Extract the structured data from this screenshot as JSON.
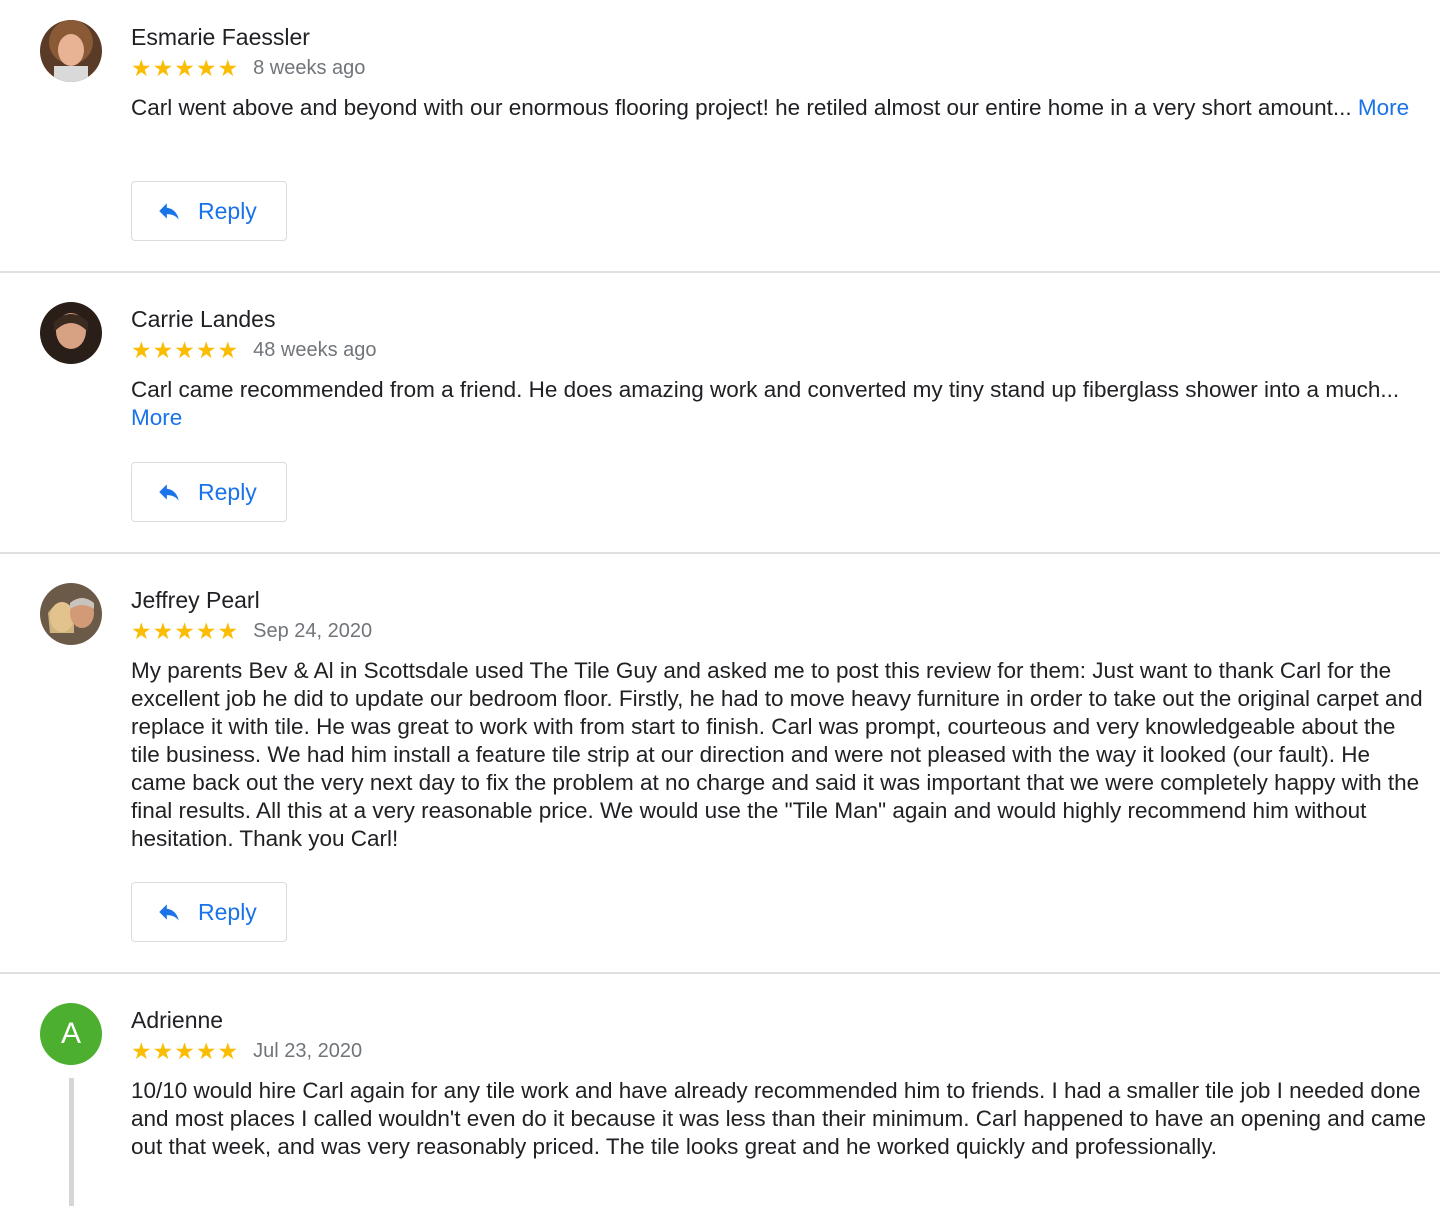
{
  "reviews": [
    {
      "author": "Esmarie Faessler",
      "rating": 5,
      "stars": "★★★★★",
      "date": "8 weeks ago",
      "text": "Carl went above and beyond with our enormous flooring project! he retiled almost our entire home in a very short amount... ",
      "more_label": "More",
      "reply_label": "Reply",
      "avatar": "photo"
    },
    {
      "author": "Carrie Landes",
      "rating": 5,
      "stars": "★★★★★",
      "date": "48 weeks ago",
      "text": "Carl came recommended from a friend. He does amazing work and converted my tiny stand up fiberglass shower into a much... ",
      "more_label": "More",
      "reply_label": "Reply",
      "avatar": "photo"
    },
    {
      "author": "Jeffrey Pearl",
      "rating": 5,
      "stars": "★★★★★",
      "date": "Sep 24, 2020",
      "text": "My parents Bev & Al in Scottsdale used The Tile Guy and asked me to post this review for them: Just want to thank Carl for the excellent job he did to update our bedroom floor. Firstly, he had to move heavy furniture in order to take out the original carpet and replace it with tile. He was great to work with from start to finish. Carl was prompt, courteous and very knowledgeable about the tile business. We had him install a feature tile strip at our direction and were not pleased with the way it looked (our fault). He came back out the very next day to fix the problem at no charge and said it was important that we were completely happy with the final results. All this at a very reasonable price. We would use the \"Tile Man\" again and would highly recommend him without hesitation. Thank you Carl!",
      "reply_label": "Reply",
      "avatar": "photo"
    },
    {
      "author": "Adrienne",
      "rating": 5,
      "stars": "★★★★★",
      "date": "Jul 23, 2020",
      "avatar_letter": "A",
      "avatar_color": "#4caf2f",
      "text": "10/10 would hire Carl again for any tile work and have already recommended him to friends. I had a smaller tile job I needed done and most places I called wouldn't even do it because it was less than their minimum. Carl happened to have an opening and came out that week, and was very reasonably priced. The tile looks great and he worked quickly and professionally."
    }
  ],
  "colors": {
    "star": "#fbbc04",
    "link": "#1a73e8",
    "meta": "#70757a",
    "divider": "#e0e0e0"
  }
}
